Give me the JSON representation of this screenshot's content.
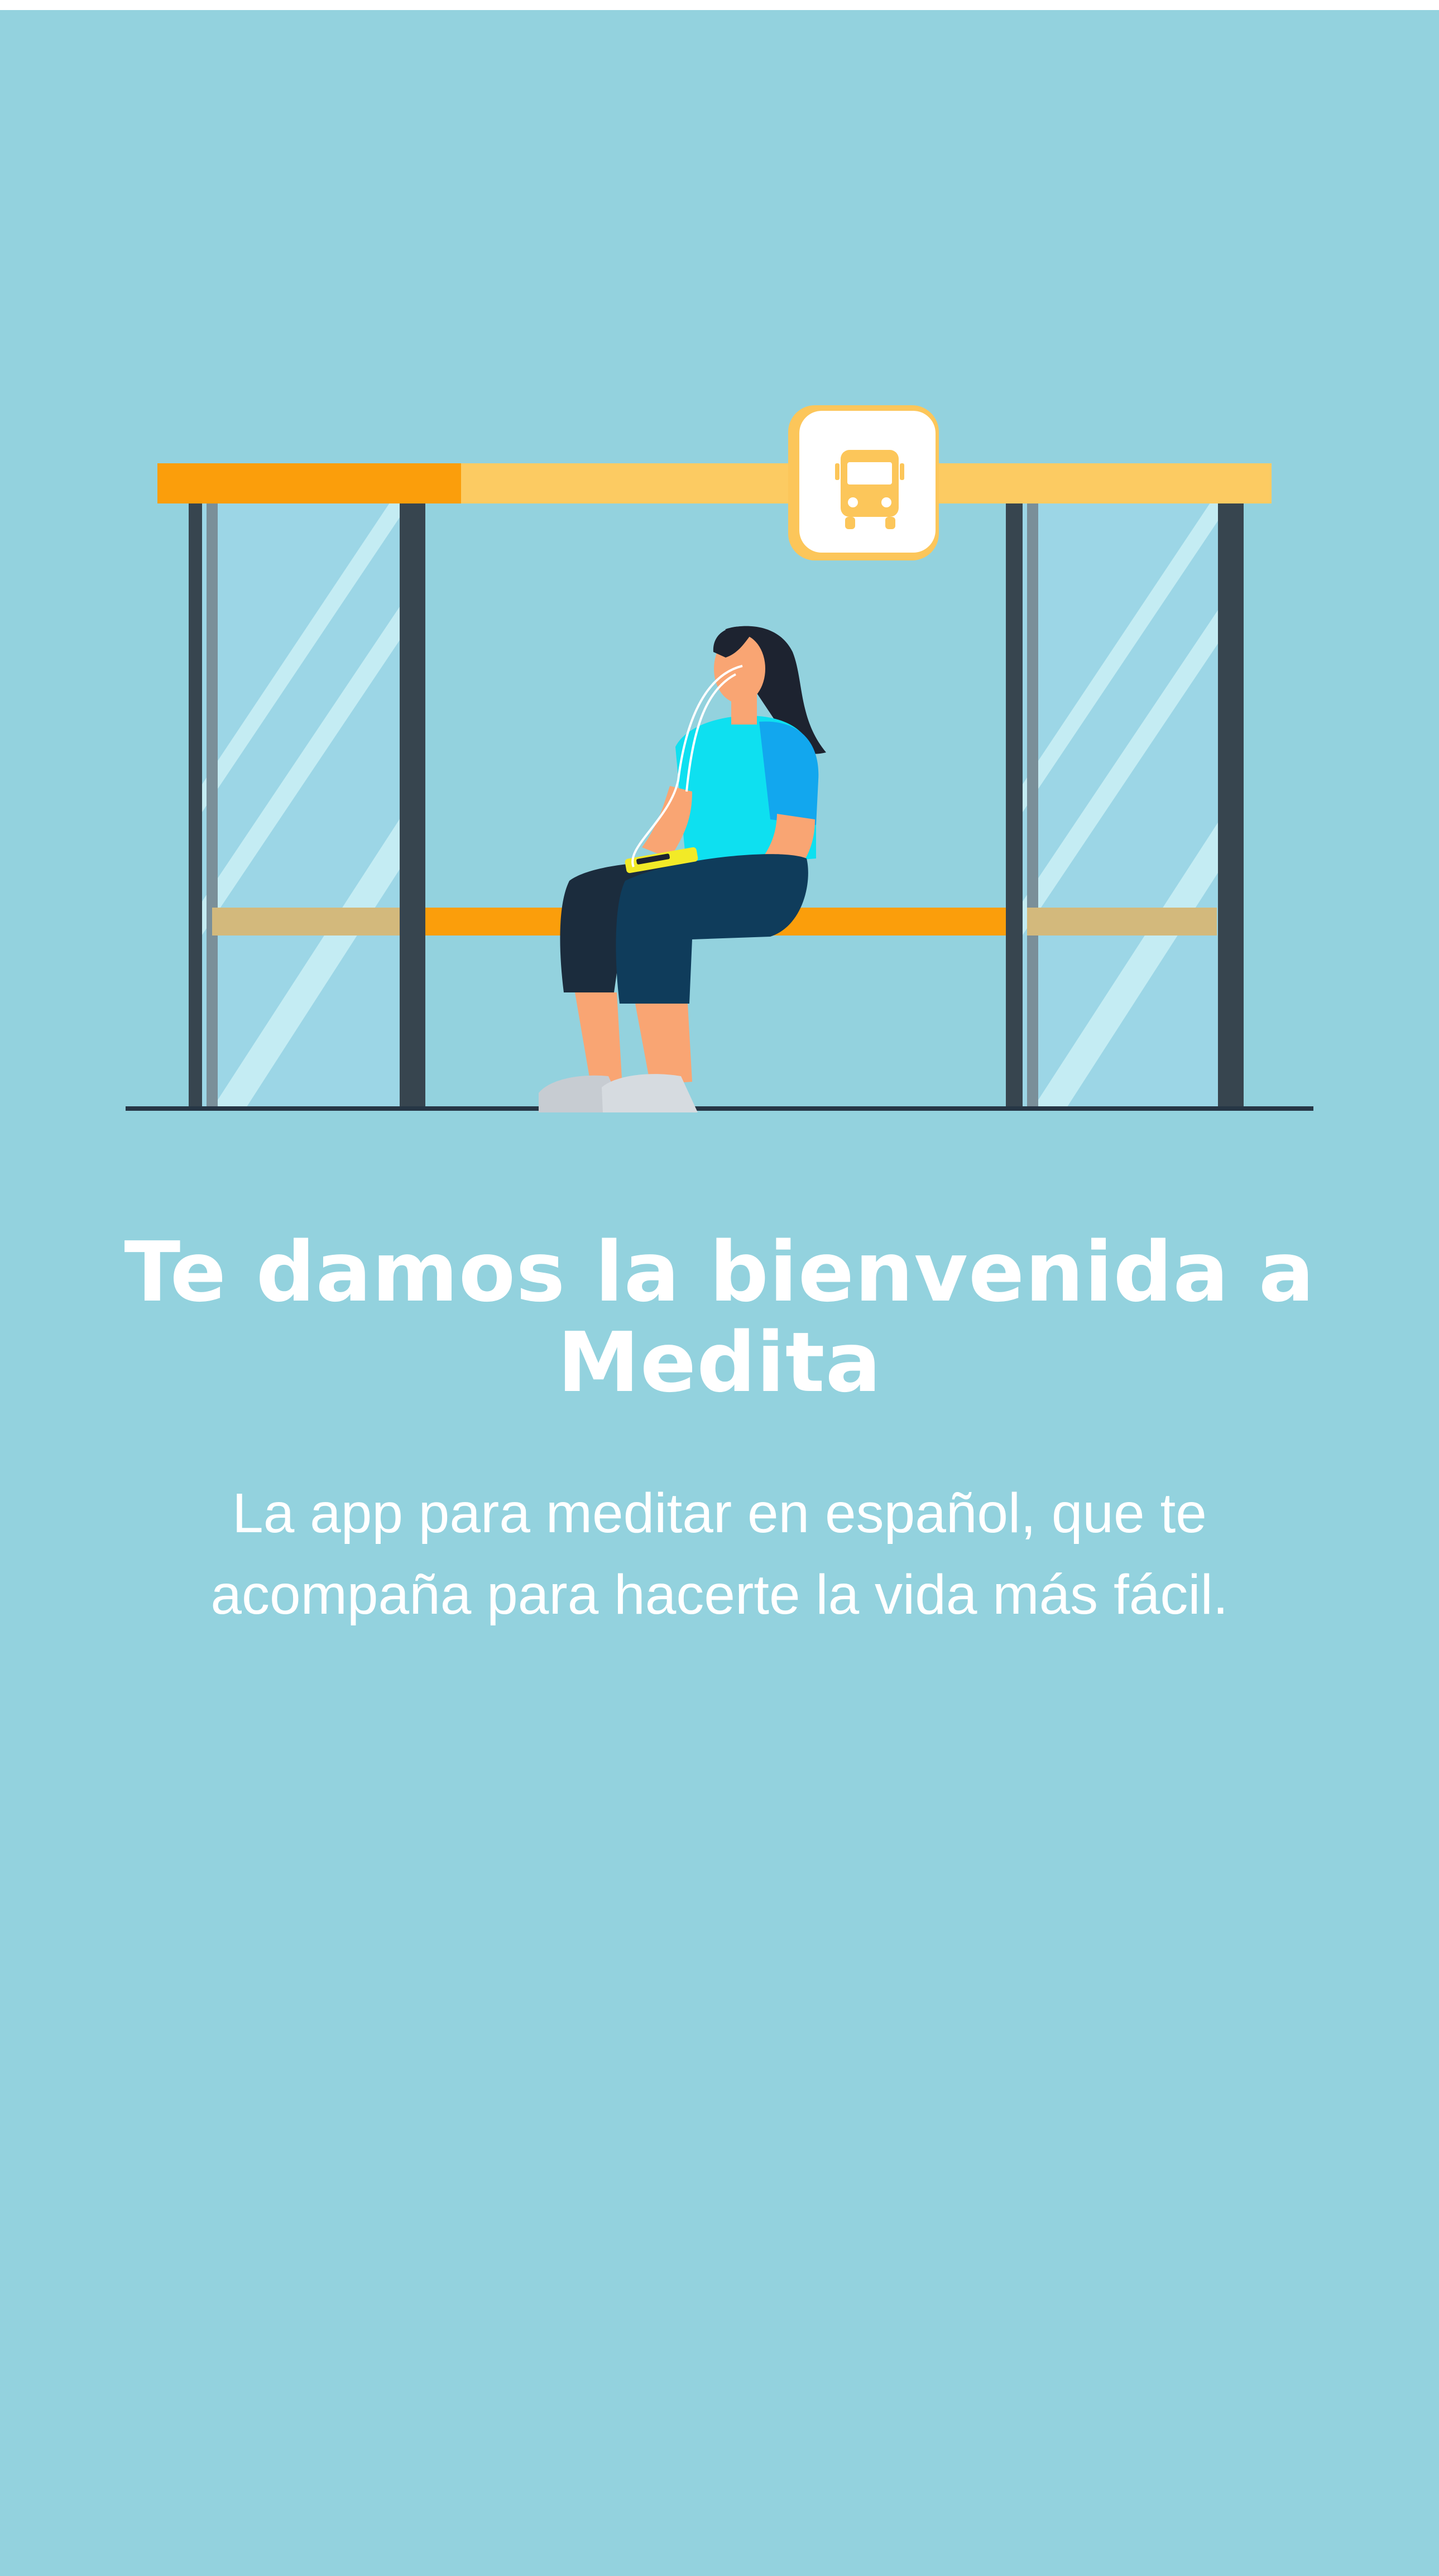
{
  "welcome": {
    "title": "Te damos la bienvenida a Medita",
    "subtitle": "La app para meditar en español, que te acompaña para hacerte la vida más fácil."
  },
  "illustration": {
    "scene": "bus-stop",
    "sign_icon": "bus-icon"
  },
  "colors": {
    "background": "#93d2de",
    "roof_orange": "#fb9e0b",
    "roof_yellow": "#fccb62",
    "post_dark": "#37454f",
    "bench_orange": "#fb9e0b",
    "shirt_cyan": "#0ee0f0",
    "sleeve_blue": "#12a7ee",
    "pants_navy": "#0f3c5b",
    "skin": "#f9a573"
  }
}
